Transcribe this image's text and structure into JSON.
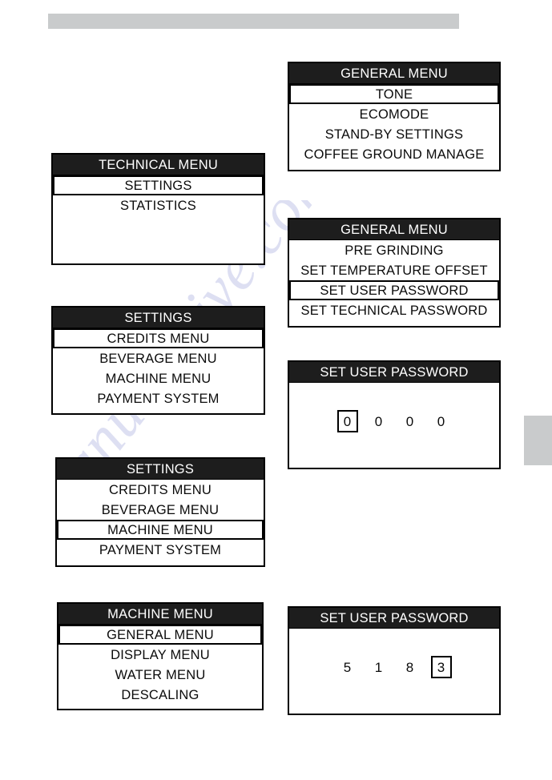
{
  "document": {
    "header_bar_color": "#c9cbcc",
    "edge_tab_color": "#c9cbcc",
    "watermark_text": "manualshive.com"
  },
  "panels": {
    "technical_menu": {
      "title": "TECHNICAL MENU",
      "rows": [
        {
          "label": "SETTINGS",
          "selected": true
        },
        {
          "label": "STATISTICS",
          "selected": false
        }
      ]
    },
    "settings_credits": {
      "title": "SETTINGS",
      "rows": [
        {
          "label": "CREDITS MENU",
          "selected": true
        },
        {
          "label": "BEVERAGE MENU",
          "selected": false
        },
        {
          "label": "MACHINE MENU",
          "selected": false
        },
        {
          "label": "PAYMENT SYSTEM",
          "selected": false
        }
      ]
    },
    "settings_machine": {
      "title": "SETTINGS",
      "rows": [
        {
          "label": "CREDITS MENU",
          "selected": false
        },
        {
          "label": "BEVERAGE MENU",
          "selected": false
        },
        {
          "label": "MACHINE MENU",
          "selected": true
        },
        {
          "label": "PAYMENT SYSTEM",
          "selected": false
        }
      ]
    },
    "machine_menu": {
      "title": "MACHINE MENU",
      "rows": [
        {
          "label": "GENERAL MENU",
          "selected": true
        },
        {
          "label": "DISPLAY MENU",
          "selected": false
        },
        {
          "label": "WATER MENU",
          "selected": false
        },
        {
          "label": "DESCALING",
          "selected": false
        }
      ]
    },
    "general_tone": {
      "title": "GENERAL MENU",
      "rows": [
        {
          "label": "TONE",
          "selected": true
        },
        {
          "label": "ECOMODE",
          "selected": false
        },
        {
          "label": "STAND-BY SETTINGS",
          "selected": false
        },
        {
          "label": "COFFEE GROUND MANAGE",
          "selected": false
        }
      ]
    },
    "general_password": {
      "title": "GENERAL MENU",
      "rows": [
        {
          "label": "PRE GRINDING",
          "selected": false
        },
        {
          "label": "SET TEMPERATURE OFFSET",
          "selected": false
        },
        {
          "label": "SET USER PASSWORD",
          "selected": true
        },
        {
          "label": "SET TECHNICAL PASSWORD",
          "selected": false
        }
      ]
    },
    "set_user_password_zero": {
      "title": "SET USER PASSWORD",
      "digits": [
        {
          "value": "0",
          "selected": true
        },
        {
          "value": "0",
          "selected": false
        },
        {
          "value": "0",
          "selected": false
        },
        {
          "value": "0",
          "selected": false
        }
      ]
    },
    "set_user_password_filled": {
      "title": "SET USER PASSWORD",
      "digits": [
        {
          "value": "5",
          "selected": false
        },
        {
          "value": "1",
          "selected": false
        },
        {
          "value": "8",
          "selected": false
        },
        {
          "value": "3",
          "selected": true
        }
      ]
    }
  }
}
